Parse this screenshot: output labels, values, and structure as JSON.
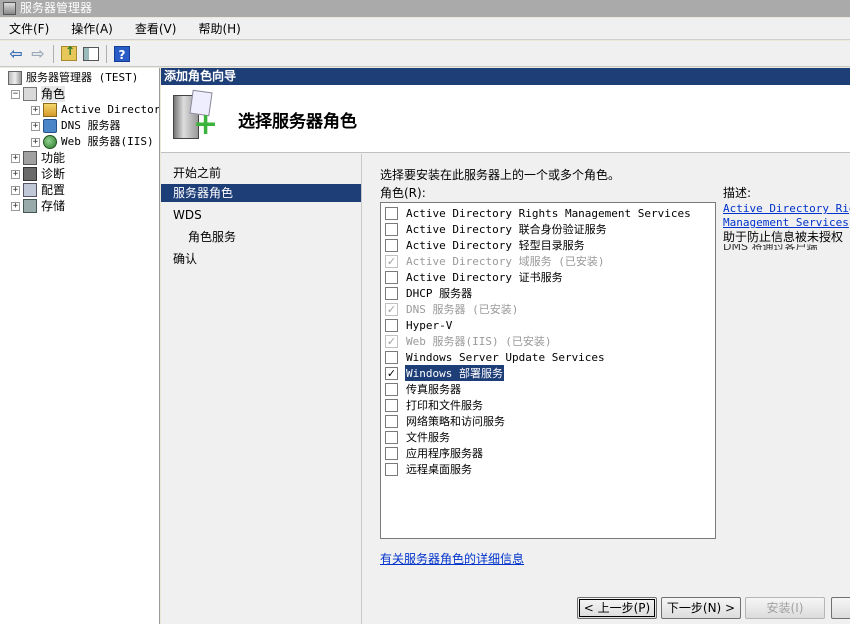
{
  "window": {
    "title": "服务器管理器"
  },
  "menu": [
    "文件(F)",
    "操作(A)",
    "查看(V)",
    "帮助(H)"
  ],
  "toolbar": {
    "back": "⇦",
    "forward": "⇨",
    "help": "?"
  },
  "tree": {
    "root": "服务器管理器 (TEST)",
    "roles": "角色",
    "role_children": [
      "Active Directory",
      "DNS 服务器",
      "Web 服务器(IIS)"
    ],
    "features": "功能",
    "diagnostics": "诊断",
    "configuration": "配置",
    "storage": "存储",
    "expand_minus": "−",
    "expand_plus": "+"
  },
  "wizard": {
    "title": "添加角色向导",
    "page_title": "选择服务器角色",
    "steps": [
      "开始之前",
      "服务器角色",
      "WDS",
      "角色服务",
      "确认"
    ],
    "instruction": "选择要安装在此服务器上的一个或多个角色。",
    "roles_label": "角色(R):",
    "description_label": "描述:",
    "roles": [
      {
        "label": "Active Directory Rights Management Services",
        "checked": false,
        "disabled": false
      },
      {
        "label": "Active Directory 联合身份验证服务",
        "checked": false,
        "disabled": false
      },
      {
        "label": "Active Directory 轻型目录服务",
        "checked": false,
        "disabled": false
      },
      {
        "label": "Active Directory 域服务  (已安装)",
        "checked": true,
        "disabled": true
      },
      {
        "label": "Active Directory 证书服务",
        "checked": false,
        "disabled": false
      },
      {
        "label": "DHCP 服务器",
        "checked": false,
        "disabled": false
      },
      {
        "label": "DNS 服务器  (已安装)",
        "checked": true,
        "disabled": true
      },
      {
        "label": "Hyper-V",
        "checked": false,
        "disabled": false
      },
      {
        "label": "Web 服务器(IIS)  (已安装)",
        "checked": true,
        "disabled": true
      },
      {
        "label": "Windows Server Update Services",
        "checked": false,
        "disabled": false
      },
      {
        "label": "Windows 部署服务",
        "checked": true,
        "disabled": false,
        "selected": true
      },
      {
        "label": "传真服务器",
        "checked": false,
        "disabled": false
      },
      {
        "label": "打印和文件服务",
        "checked": false,
        "disabled": false
      },
      {
        "label": "网络策略和访问服务",
        "checked": false,
        "disabled": false
      },
      {
        "label": "文件服务",
        "checked": false,
        "disabled": false
      },
      {
        "label": "应用程序服务器",
        "checked": false,
        "disabled": false
      },
      {
        "label": "远程桌面服务",
        "checked": false,
        "disabled": false
      }
    ],
    "check_mark": "✓",
    "description": {
      "link_line1": "Active Directory Rights",
      "link_line2": "Management Services",
      "text": "助于防止信息被未授权"
    },
    "more_info_link": "有关服务器角色的详细信息",
    "buttons": {
      "previous": "< 上一步(P)",
      "next": "下一步(N) >",
      "install": "安装(I)"
    }
  }
}
